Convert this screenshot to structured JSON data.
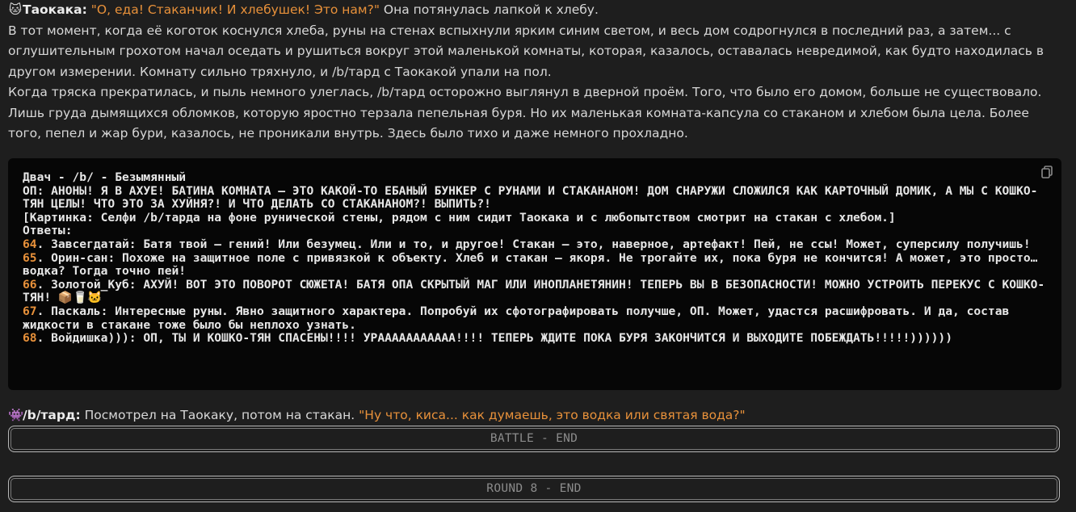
{
  "para1": {
    "emoji": "🐱",
    "speaker": "Таокака:",
    "quote": "\"О, еда! Стаканчик! И хлебушек! Это нам?\"",
    "rest": " Она потянулась лапкой к хлебу."
  },
  "para2": "В тот момент, когда её коготок коснулся хлеба, руны на стенах вспыхнули ярким синим светом, и весь дом содрогнулся в последний раз, а затем... с оглушительным грохотом начал оседать и рушиться вокруг этой маленькой комнаты, которая, казалось, оставалась невредимой, как будто находилась в другом измерении. Комнату сильно тряхнуло, и /b/тард с Таокакой упали на пол.",
  "para3": "Когда тряска прекратилась, и пыль немного улеглась, /b/тард осторожно выглянул в дверной проём. Того, что было его домом, больше не существовало. Лишь груда дымящихся обломков, которую яростно терзала пепельная буря. Но их маленькая комната-капсула со стаканом и хлебом была цела. Более того, пепел и жар бури, казалось, не проникали внутрь. Здесь было тихо и даже немного прохладно.",
  "code": {
    "copy_icon": "copy-icon",
    "header": "Двач - /b/ - Безымянный",
    "op": "ОП: АНОНЫ! Я В АХУЕ! БАТИНА КОМНАТА – ЭТО КАКОЙ-ТО ЕБАНЫЙ БУНКЕР С РУНАМИ И СТАКАНАНОМ! ДОМ СНАРУЖИ СЛОЖИЛСЯ КАК КАРТОЧНЫЙ ДОМИК, А МЫ С КОШКО-ТЯН ЦЕЛЫ! ЧТО ЭТО ЗА ХУЙНЯ?! И ЧТО ДЕЛАТЬ СО СТАКАНАНОМ?! ВЫПИТЬ?!",
    "image": "[Картинка: Селфи /b/тарда на фоне рунической стены, рядом с ним сидит Таокака и с любопытством смотрит на стакан с хлебом.]",
    "answers_label": "Ответы:",
    "replies": [
      {
        "num": "64",
        "text": ". Завсегдатай: Батя твой – гений! Или безумец. Или и то, и другое! Стакан – это, наверное, артефакт! Пей, не ссы! Может, суперсилу получишь!"
      },
      {
        "num": "65",
        "text": ". Орин-сан: Похоже на защитное поле с привязкой к объекту. Хлеб и стакан – якоря. Не трогайте их, пока буря не кончится! А может, это просто… водка? Тогда точно пей!"
      },
      {
        "num": "66",
        "text": ". Золотой_Куб: АХУЙ! ВОТ ЭТО ПОВОРОТ СЮЖЕТА! БАТЯ ОПА СКРЫТЫЙ МАГ ИЛИ ИНОПЛАНЕТЯНИН! ТЕПЕРЬ ВЫ В БЕЗОПАСНОСТИ! МОЖНО УСТРОИТЬ ПЕРЕКУС С КОШКО-ТЯН! 📦🥛🐱"
      },
      {
        "num": "67",
        "text": ". Паскаль: Интересные руны. Явно защитного характера. Попробуй их сфотографировать получше, ОП. Может, удастся расшифровать. И да, состав жидкости в стакане тоже было бы неплохо узнать."
      },
      {
        "num": "68",
        "text": ". Войдишка))): ОП, ТЫ И КОШКО-ТЯН СПАСЕНЫ!!!! УРААААААААААА!!!! ТЕПЕРЬ ЖДИТЕ ПОКА БУРЯ ЗАКОНЧИТСЯ И ВЫХОДИТЕ ПОБЕЖДАТЬ!!!!!))))))"
      }
    ]
  },
  "para4": {
    "emoji": "👾",
    "speaker": "/b/тард:",
    "rest": " Посмотрел на Таокаку, потом на стакан. ",
    "quote": "\"Ну что, киса... как думаешь, это водка или святая вода?\""
  },
  "banners": {
    "battle_end": "BATTLE - END",
    "round_end": "ROUND 8 - END"
  }
}
